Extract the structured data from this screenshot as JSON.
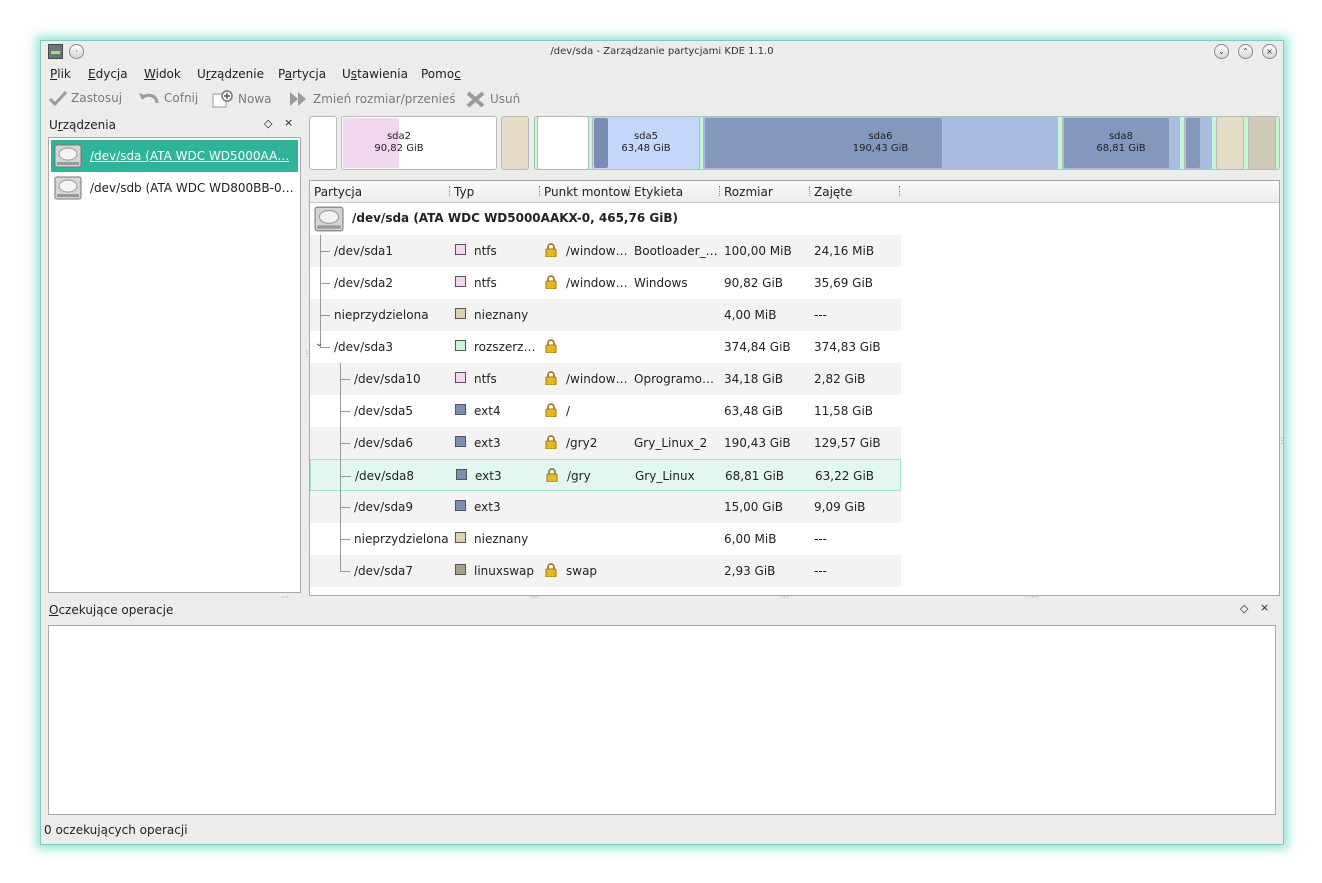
{
  "window": {
    "title": "/dev/sda - Zarządzanie partycjami KDE 1.1.0"
  },
  "menu": [
    {
      "pre": "",
      "ul": "P",
      "post": "lik"
    },
    {
      "pre": "",
      "ul": "E",
      "post": "dycja"
    },
    {
      "pre": "",
      "ul": "W",
      "post": "idok"
    },
    {
      "pre": "U",
      "ul": "r",
      "post": "ządzenie"
    },
    {
      "pre": "P",
      "ul": "a",
      "post": "rtycja"
    },
    {
      "pre": "U",
      "ul": "s",
      "post": "tawienia"
    },
    {
      "pre": "Pomo",
      "ul": "c",
      "post": ""
    }
  ],
  "toolbar": {
    "apply": "Zastosuj",
    "undo": "Cofnij",
    "new": "Nowa",
    "resize": "Zmień rozmiar/przenieś",
    "delete": "Usuń"
  },
  "devices": {
    "title_pre": "U",
    "title_ul": "r",
    "title_post": "ządzenia",
    "ctrl_float": "◇",
    "ctrl_close": "×",
    "items": [
      {
        "label": "/dev/sda (ATA WDC WD5000AA…",
        "selected": true
      },
      {
        "label": "/dev/sdb (ATA WDC WD800BB-0…",
        "selected": false
      }
    ]
  },
  "partition_bar": {
    "sda2": {
      "name": "sda2",
      "size": "90,82 GiB"
    },
    "sda5": {
      "name": "sda5",
      "size": "63,48 GiB"
    },
    "sda6": {
      "name": "sda6",
      "size": "190,43 GiB"
    },
    "sda8": {
      "name": "sda8",
      "size": "68,81 GiB"
    }
  },
  "tree": {
    "columns": [
      "Partycja",
      "Typ",
      "Punkt montow",
      "Etykieta",
      "Rozmiar",
      "Zajęte"
    ],
    "disk": "/dev/sda (ATA WDC WD5000AAKX-0, 465,76 GiB)",
    "expander": "⌄",
    "rows": [
      {
        "partition": "/dev/sda1",
        "type": "ntfs",
        "color": "#f4d5f2",
        "locked": true,
        "mount": "/window…",
        "label": "Bootloader_…",
        "size": "100,00 MiB",
        "used": "24,16 MiB",
        "level": 1
      },
      {
        "partition": "/dev/sda2",
        "type": "ntfs",
        "color": "#f4d5f2",
        "locked": true,
        "mount": "/window…",
        "label": "Windows",
        "size": "90,82 GiB",
        "used": "35,69 GiB",
        "level": 1
      },
      {
        "partition": "nieprzydzielona",
        "type": "nieznany",
        "color": "#ddd0b4",
        "locked": false,
        "mount": "",
        "label": "",
        "size": "4,00 MiB",
        "used": "---",
        "level": 1
      },
      {
        "partition": "/dev/sda3",
        "type": "rozszerz…",
        "color": "#c8f5d5",
        "locked": true,
        "mount": "",
        "label": "",
        "size": "374,84 GiB",
        "used": "374,83 GiB",
        "level": 1
      },
      {
        "partition": "/dev/sda10",
        "type": "ntfs",
        "color": "#f4d5f2",
        "locked": true,
        "mount": "/window…",
        "label": "Oprogramo…",
        "size": "34,18 GiB",
        "used": "2,82 GiB",
        "level": 2
      },
      {
        "partition": "/dev/sda5",
        "type": "ext4",
        "color": "#7a8db5",
        "locked": true,
        "mount": "/",
        "label": "",
        "size": "63,48 GiB",
        "used": "11,58 GiB",
        "level": 2
      },
      {
        "partition": "/dev/sda6",
        "type": "ext3",
        "color": "#7a8db5",
        "locked": true,
        "mount": "/gry2",
        "label": "Gry_Linux_2",
        "size": "190,43 GiB",
        "used": "129,57 GiB",
        "level": 2
      },
      {
        "partition": "/dev/sda8",
        "type": "ext3",
        "color": "#7a8db5",
        "locked": true,
        "mount": "/gry",
        "label": "Gry_Linux",
        "size": "68,81 GiB",
        "used": "63,22 GiB",
        "level": 2
      },
      {
        "partition": "/dev/sda9",
        "type": "ext3",
        "color": "#7a8db5",
        "locked": false,
        "mount": "",
        "label": "",
        "size": "15,00 GiB",
        "used": "9,09 GiB",
        "level": 2
      },
      {
        "partition": "nieprzydzielona",
        "type": "nieznany",
        "color": "#ddd0b4",
        "locked": false,
        "mount": "",
        "label": "",
        "size": "6,00 MiB",
        "used": "---",
        "level": 2
      },
      {
        "partition": "/dev/sda7",
        "type": "linuxswap",
        "color": "#a6a088",
        "locked": true,
        "mount": "swap",
        "label": "",
        "size": "2,93 GiB",
        "used": "---",
        "level": 2
      }
    ]
  },
  "pending": {
    "title_pre": "",
    "title_ul": "O",
    "title_post": "czekujące operacje",
    "ctrl_float": "◇",
    "ctrl_close": "×"
  },
  "status": {
    "text": "0 oczekujących operacji"
  },
  "colors": {
    "accent": "#2fb49a",
    "ntfs": "#f4d5f2",
    "ext": "#7a8db5",
    "unallocated": "#ddd0b4",
    "extended": "#c8f5d5",
    "swap": "#a6a088"
  }
}
